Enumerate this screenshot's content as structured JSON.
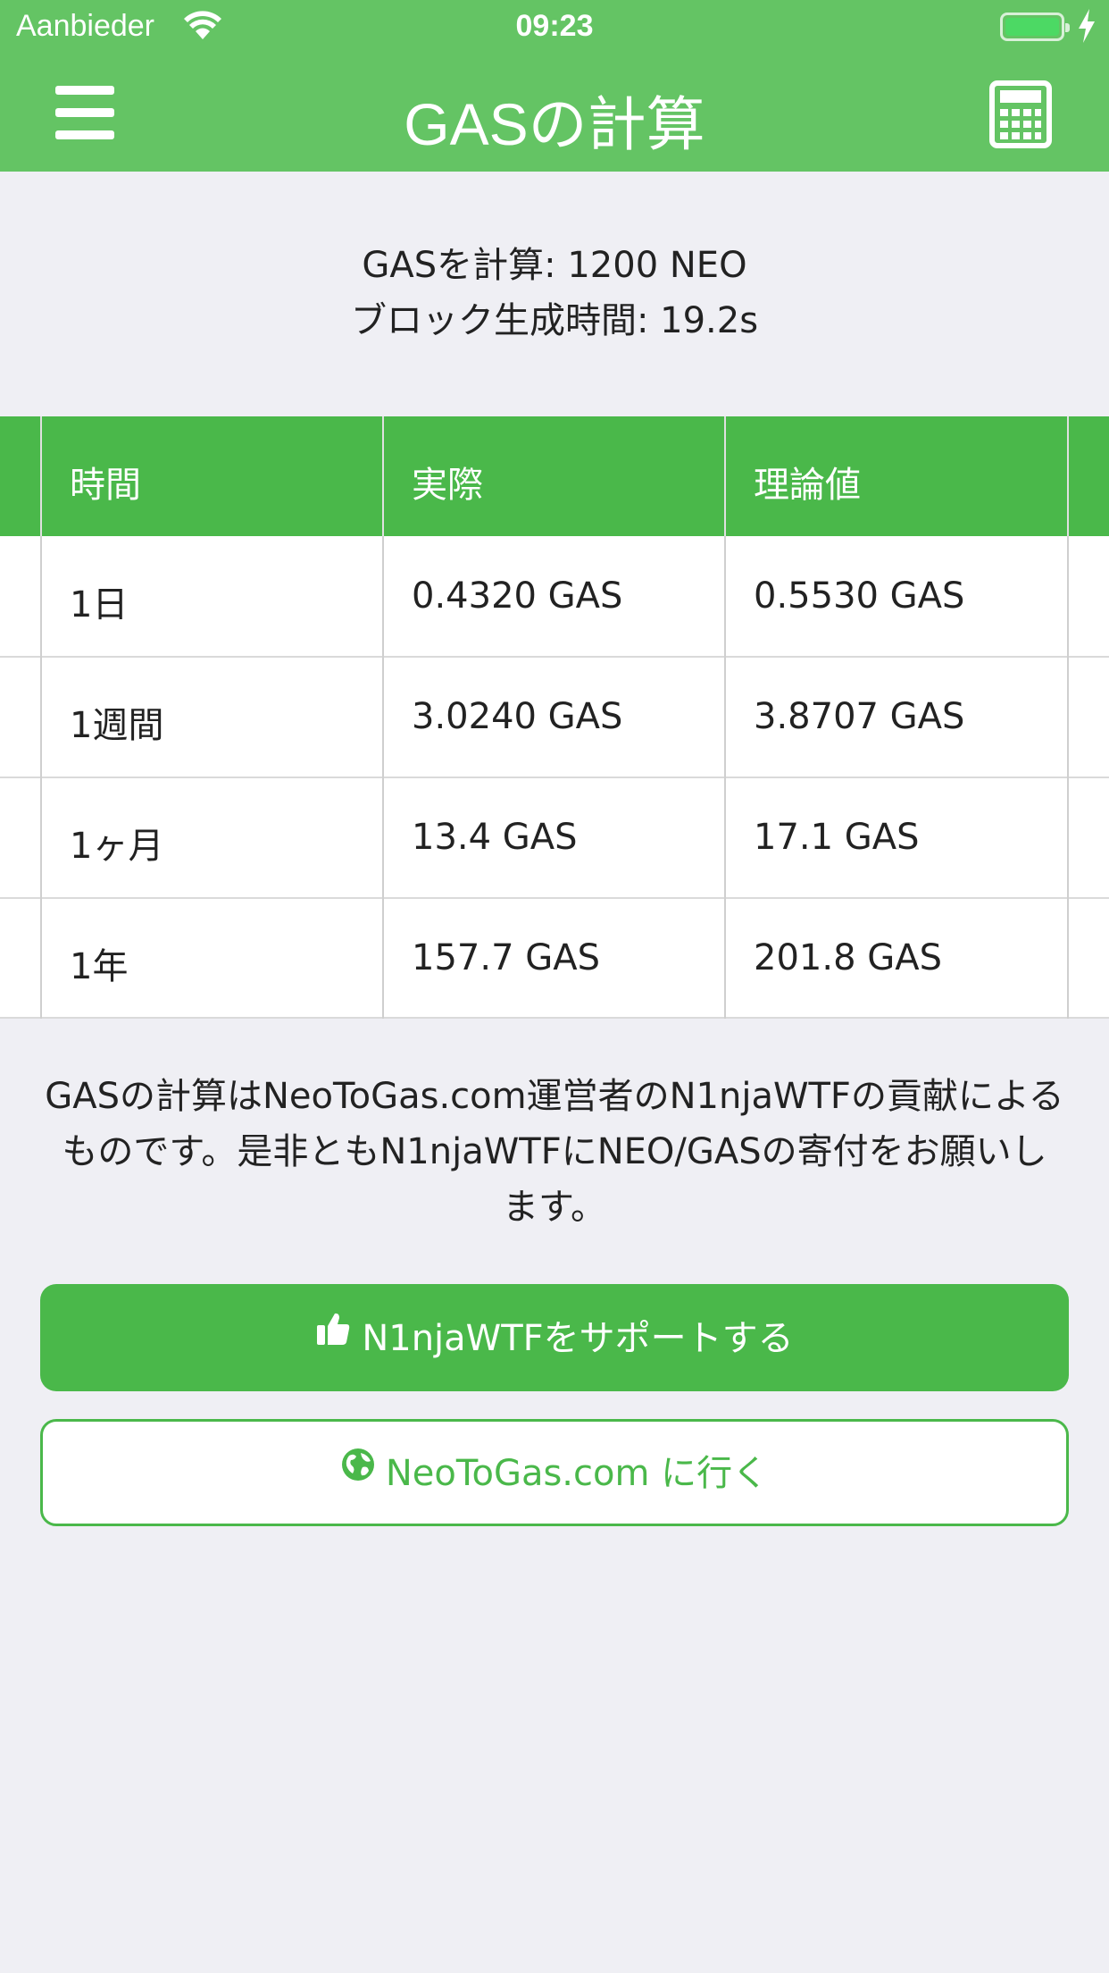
{
  "status_bar": {
    "carrier": "Aanbieder",
    "time": "09:23",
    "wifi_icon": "wifi-icon",
    "battery_icon": "battery-charging-icon"
  },
  "nav": {
    "title": "GASの計算",
    "menu_icon": "hamburger-menu-icon",
    "calculator_icon": "calculator-icon"
  },
  "summary": {
    "line1": "GASを計算: 1200 NEO",
    "line2": "ブロック生成時間: 19.2s"
  },
  "table": {
    "headers": [
      "時間",
      "実際",
      "理論値"
    ],
    "rows": [
      [
        "1日",
        "0.4320 GAS",
        "0.5530 GAS"
      ],
      [
        "1週間",
        "3.0240 GAS",
        "3.8707 GAS"
      ],
      [
        "1ヶ月",
        "13.4 GAS",
        "17.1 GAS"
      ],
      [
        "1年",
        "157.7 GAS",
        "201.8 GAS"
      ]
    ]
  },
  "note": {
    "line1": "GASの計算はNeoToGas.com運営者のN1njaWTFの貢献による",
    "line2": "ものです。是非ともN1njaWTFにNEO/GASの寄付をお願いし",
    "line3": "ます。"
  },
  "buttons": {
    "support_label": "N1njaWTFをサポートする",
    "support_icon": "thumbs-up-icon",
    "visit_label": "NeoToGas.com に行く",
    "visit_icon": "globe-icon"
  },
  "colors": {
    "header": "#64c464",
    "accent": "#4ab84a",
    "background": "#efeff4"
  }
}
